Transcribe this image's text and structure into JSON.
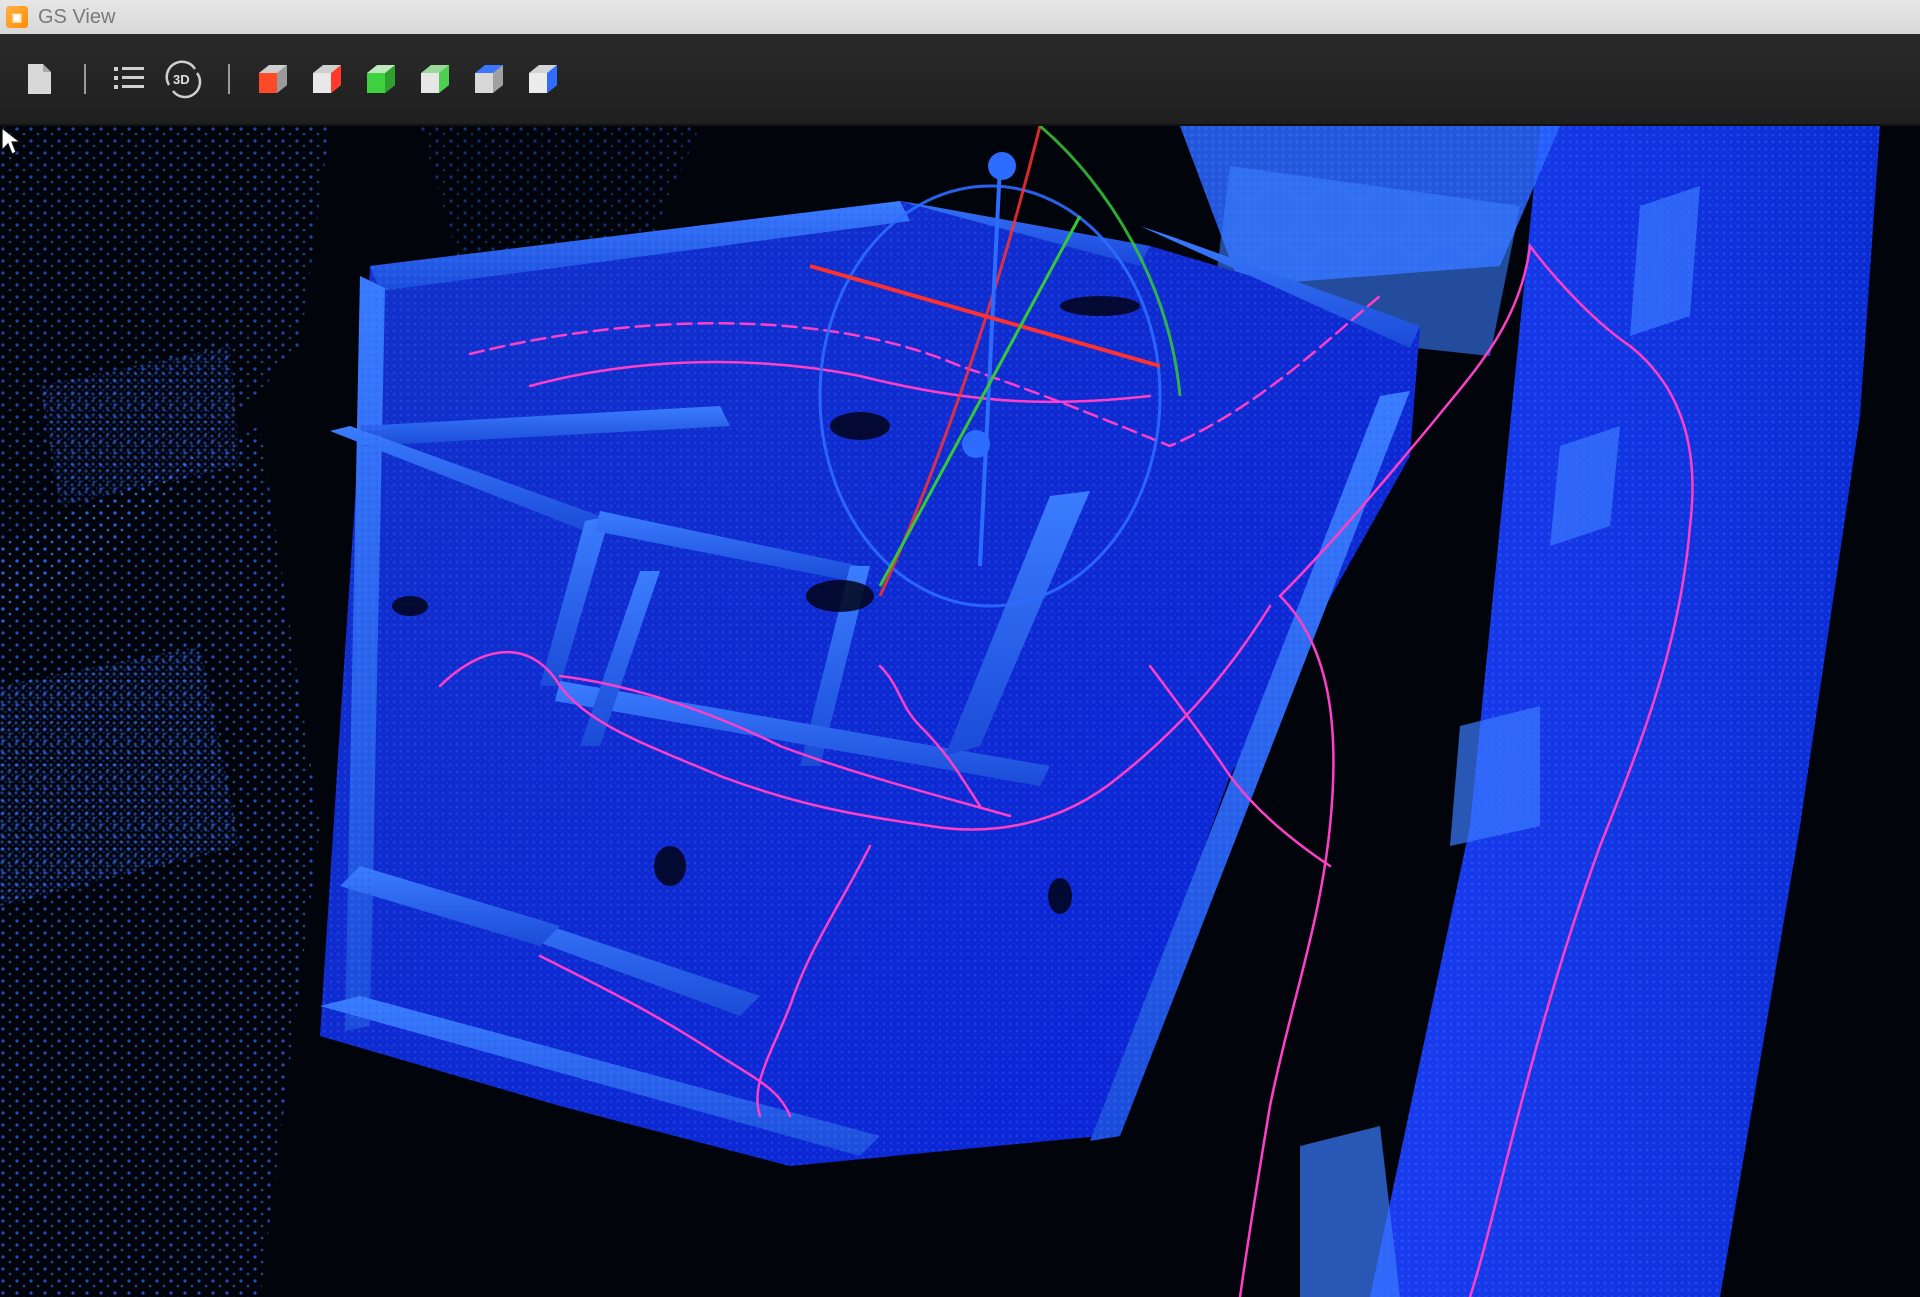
{
  "window": {
    "title": "GS View",
    "app_icon": "app-logo-icon"
  },
  "toolbar": {
    "buttons": [
      {
        "name": "file-button",
        "icon": "document-icon"
      },
      {
        "name": "layers-button",
        "icon": "list-icon"
      },
      {
        "name": "view-3d-button",
        "icon": "rotate-3d-icon",
        "label": "3D"
      },
      {
        "name": "view-cube-red-button",
        "icon": "cube-red-icon"
      },
      {
        "name": "view-cube-red-alt-button",
        "icon": "cube-red-alt-icon"
      },
      {
        "name": "view-cube-green-button",
        "icon": "cube-green-icon"
      },
      {
        "name": "view-cube-green-alt-button",
        "icon": "cube-green-alt-icon"
      },
      {
        "name": "view-cube-blue-button",
        "icon": "cube-blue-icon"
      },
      {
        "name": "view-cube-blue-alt-button",
        "icon": "cube-blue-alt-icon"
      }
    ]
  },
  "colors": {
    "point_cloud": "#1f5eff",
    "point_cloud_bright": "#3d8cff",
    "trajectory": "#ff3fc8",
    "gizmo_red": "#ff3030",
    "gizmo_green": "#37c837",
    "gizmo_blue": "#2c6cff"
  },
  "viewport": {
    "content": "3d-point-cloud",
    "gizmo": "transform-gizmo-icon",
    "cursor": "mouse-pointer-icon"
  }
}
